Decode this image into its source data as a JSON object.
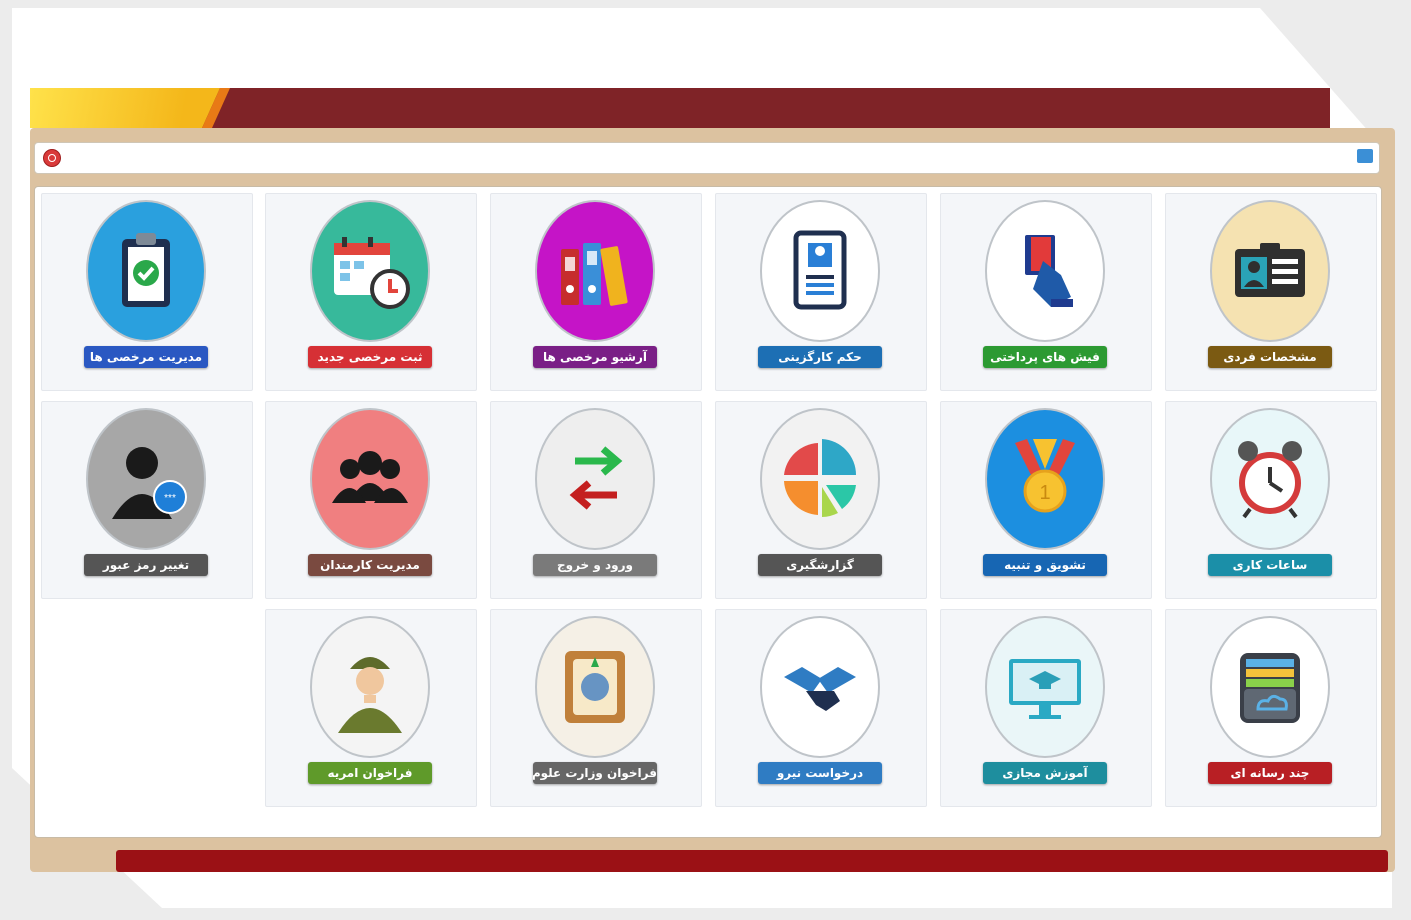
{
  "header": {
    "logo_title": "",
    "logo_subtitle": ""
  },
  "toolbar": {
    "left_text": "",
    "right_text": ""
  },
  "tiles": [
    {
      "label": "مشخصات فردی",
      "color": "#7b5a12",
      "icon": "id-card-icon",
      "bg": "#f5e2b1"
    },
    {
      "label": "فیش های پرداختی",
      "color": "#2c9a32",
      "icon": "payslip-hand-icon",
      "bg": "#ffffff"
    },
    {
      "label": "حکم کارگزینی",
      "color": "#1d6fb4",
      "icon": "employee-document-icon",
      "bg": "#ffffff"
    },
    {
      "label": "آرشیو مرخصی ها",
      "color": "#7a1f86",
      "icon": "binders-icon",
      "bg": "#c514c7"
    },
    {
      "label": "ثبت مرخصی جدید",
      "color": "#d63035",
      "icon": "calendar-clock-icon",
      "bg": "#37b99b"
    },
    {
      "label": "مدیریت مرخصی ها",
      "color": "#2a58c2",
      "icon": "clipboard-check-icon",
      "bg": "#2aa0de"
    },
    {
      "label": "ساعات کاری",
      "color": "#1b8fa8",
      "icon": "alarm-clock-icon",
      "bg": "#e8f7f9"
    },
    {
      "label": "تشویق و تنبیه",
      "color": "#1766b3",
      "icon": "medal-icon",
      "bg": "#1c8fe0"
    },
    {
      "label": "گزارشگیری",
      "color": "#555555",
      "icon": "pie-chart-icon",
      "bg": "#f2f2f2"
    },
    {
      "label": "ورود و خروج",
      "color": "#7a7a7a",
      "icon": "enter-exit-arrows-icon",
      "bg": "#eeeeee"
    },
    {
      "label": "مدیریت کارمندان",
      "color": "#7a4a40",
      "icon": "people-group-icon",
      "bg": "#f07f80"
    },
    {
      "label": "تغییر رمز عبور",
      "color": "#555555",
      "icon": "user-password-icon",
      "bg": "#a7a7a7"
    },
    {
      "label": "چند رسانه ای",
      "color": "#b81f24",
      "icon": "cloud-folder-icon",
      "bg": "#ffffff"
    },
    {
      "label": "آموزش مجازی",
      "color": "#1e8e9e",
      "icon": "e-learning-icon",
      "bg": "#eaf6f8"
    },
    {
      "label": "درخواست نیرو",
      "color": "#2f7cc3",
      "icon": "handshake-icon",
      "bg": "#ffffff"
    },
    {
      "label": "فراخوان وزارت علوم",
      "color": "#666666",
      "icon": "ministry-emblem-icon",
      "bg": "#f5f0e6"
    },
    {
      "label": "فراخوان امریه",
      "color": "#5f9a2a",
      "icon": "soldier-icon",
      "bg": "#f4f4f4"
    }
  ],
  "footer": {
    "text": ""
  }
}
